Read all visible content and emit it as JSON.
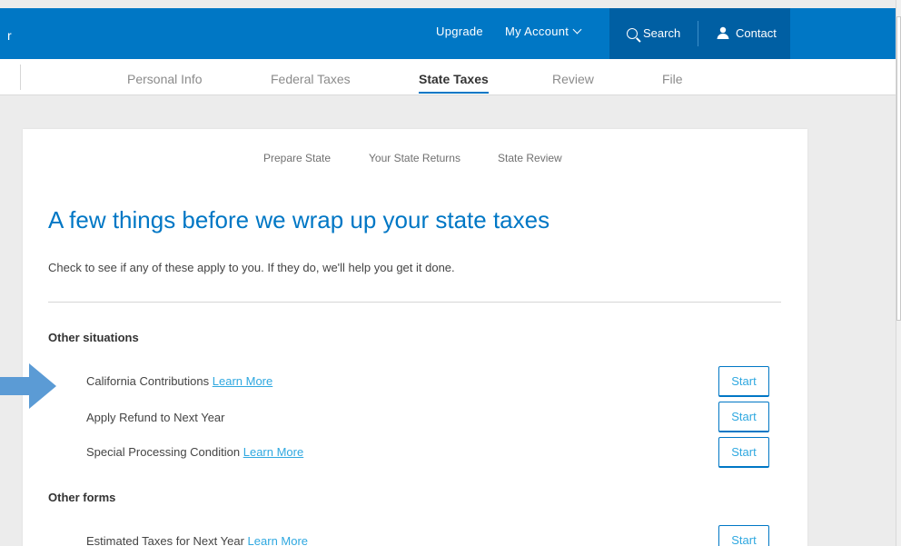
{
  "header": {
    "brand_fragment": "r",
    "upgrade": "Upgrade",
    "my_account": "My Account",
    "search": "Search",
    "contact": "Contact"
  },
  "tabs": [
    {
      "label": "Personal Info"
    },
    {
      "label": "Federal Taxes"
    },
    {
      "label": "State Taxes",
      "active": true
    },
    {
      "label": "Review"
    },
    {
      "label": "File"
    }
  ],
  "subnav": [
    "Prepare State",
    "Your State Returns",
    "State Review"
  ],
  "main": {
    "title": "A few things before we wrap up your state taxes",
    "intro": "Check to see if any of these apply to you. If they do, we'll help you get it done.",
    "sections": [
      {
        "heading": "Other situations",
        "items": [
          {
            "label": "California Contributions",
            "link": "Learn More",
            "button": "Start"
          },
          {
            "label": "Apply Refund to Next Year",
            "link": "",
            "button": "Start"
          },
          {
            "label": "Special Processing Condition",
            "link": "Learn More",
            "button": "Start"
          }
        ]
      },
      {
        "heading": "Other forms",
        "items": [
          {
            "label": "Estimated Taxes for Next Year",
            "link": "Learn More",
            "button": "Start"
          }
        ]
      }
    ]
  },
  "colors": {
    "brand_blue": "#0077c5",
    "brand_dark": "#005fa3",
    "link_blue": "#2fa8e0",
    "arrow_blue": "#5b9bd5"
  }
}
